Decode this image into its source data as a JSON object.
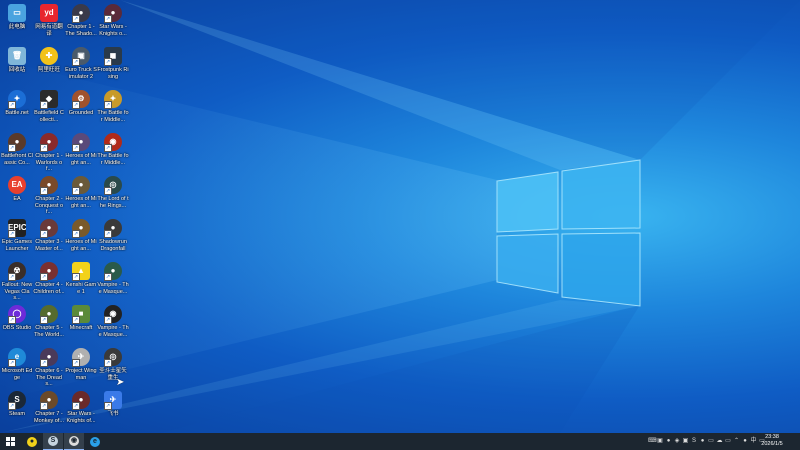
{
  "desktop_icons": [
    {
      "label": "此电脑",
      "icon": "this-pc-icon",
      "color": "#4aa3df",
      "glyph": "▭",
      "round": false,
      "shortcut": false
    },
    {
      "label": "回收站",
      "icon": "recycle-bin-icon",
      "color": "#7fb6d9",
      "glyph": "🗑",
      "round": false,
      "shortcut": false
    },
    {
      "label": "Battle.net",
      "icon": "battlenet-icon",
      "color": "#1b6ed6",
      "glyph": "✦",
      "round": true,
      "shortcut": true
    },
    {
      "label": "Battlefront Classic Co...",
      "icon": "battlefront-classic-icon",
      "color": "#5a3a2a",
      "glyph": "●",
      "round": true,
      "shortcut": true
    },
    {
      "label": "EA",
      "icon": "ea-icon",
      "color": "#e8402e",
      "glyph": "EA",
      "round": true,
      "shortcut": false
    },
    {
      "label": "Epic Games Launcher",
      "icon": "epic-games-icon",
      "color": "#222222",
      "glyph": "EPIC",
      "round": false,
      "shortcut": true
    },
    {
      "label": "Fallout: New Vegas Clas...",
      "icon": "fallout-icon",
      "color": "#3a2e2a",
      "glyph": "☢",
      "round": true,
      "shortcut": true
    },
    {
      "label": "OBS Studio",
      "icon": "obs-icon",
      "color": "#6d2bd9",
      "glyph": "◯",
      "round": true,
      "shortcut": true
    },
    {
      "label": "Microsoft Edge",
      "icon": "edge-icon",
      "color": "#1f8ad8",
      "glyph": "e",
      "round": true,
      "shortcut": true
    },
    {
      "label": "Steam",
      "icon": "steam-icon",
      "color": "#1b2838",
      "glyph": "S",
      "round": true,
      "shortcut": true
    },
    {
      "label": "网易有道翻译",
      "icon": "youdao-icon",
      "color": "#e8262e",
      "glyph": "yd",
      "round": false,
      "shortcut": false
    },
    {
      "label": "阿里旺旺",
      "icon": "aliwangwang-icon",
      "color": "#f2c21a",
      "glyph": "✚",
      "round": true,
      "shortcut": false
    },
    {
      "label": "Battlefield Collecti...",
      "icon": "battlefield-icon",
      "color": "#2b2b2b",
      "glyph": "◆",
      "round": false,
      "shortcut": true
    },
    {
      "label": "Chapter 1 - Warlords of...",
      "icon": "chapter1-icon",
      "color": "#8a2a2a",
      "glyph": "●",
      "round": true,
      "shortcut": true
    },
    {
      "label": "Chapter 2 - Conquest of...",
      "icon": "chapter2-icon",
      "color": "#7a4a2a",
      "glyph": "●",
      "round": true,
      "shortcut": true
    },
    {
      "label": "Chapter 3 - Master of...",
      "icon": "chapter3-icon",
      "color": "#6a3a3a",
      "glyph": "●",
      "round": true,
      "shortcut": true
    },
    {
      "label": "Chapter 4 - Children of...",
      "icon": "chapter4-icon",
      "color": "#7a3030",
      "glyph": "●",
      "round": true,
      "shortcut": true
    },
    {
      "label": "Chapter 5 - The World...",
      "icon": "chapter5-icon",
      "color": "#556b2f",
      "glyph": "●",
      "round": true,
      "shortcut": true
    },
    {
      "label": "Chapter 6 - The Dreads...",
      "icon": "chapter6-icon",
      "color": "#4a3a5a",
      "glyph": "●",
      "round": true,
      "shortcut": true
    },
    {
      "label": "Chapter 7 - Monkey of...",
      "icon": "chapter7-icon",
      "color": "#6b4a2a",
      "glyph": "●",
      "round": true,
      "shortcut": true
    },
    {
      "label": "Chapter 1 - The Shado...",
      "icon": "chapter-shado-icon",
      "color": "#3a3a4a",
      "glyph": "●",
      "round": true,
      "shortcut": true
    },
    {
      "label": "Euro Truck Simulator 2",
      "icon": "euro-truck-icon",
      "color": "#4a5a6a",
      "glyph": "▣",
      "round": true,
      "shortcut": true
    },
    {
      "label": "Grounded",
      "icon": "grounded-icon",
      "color": "#a0522d",
      "glyph": "⚙",
      "round": true,
      "shortcut": true
    },
    {
      "label": "Heroes of Might an...",
      "icon": "heroes1-icon",
      "color": "#5a4a7a",
      "glyph": "●",
      "round": true,
      "shortcut": true
    },
    {
      "label": "Heroes of Might an...",
      "icon": "heroes2-icon",
      "color": "#6a5a3a",
      "glyph": "●",
      "round": true,
      "shortcut": true
    },
    {
      "label": "Heroes of Might an...",
      "icon": "heroes3-icon",
      "color": "#7a5a2a",
      "glyph": "●",
      "round": true,
      "shortcut": true
    },
    {
      "label": "Kenshi Game 1",
      "icon": "kenshi-icon",
      "color": "#f2d21a",
      "glyph": "▲",
      "round": false,
      "shortcut": true
    },
    {
      "label": "Minecraft",
      "icon": "minecraft-icon",
      "color": "#5a8a3a",
      "glyph": "■",
      "round": false,
      "shortcut": true
    },
    {
      "label": "Project Wingman",
      "icon": "project-wingman-icon",
      "color": "#b0b0b0",
      "glyph": "✈",
      "round": true,
      "shortcut": true
    },
    {
      "label": "Star Wars - Knights of...",
      "icon": "kotor1-icon",
      "color": "#6a2a2a",
      "glyph": "●",
      "round": true,
      "shortcut": true
    },
    {
      "label": "Star Wars - Knights o...",
      "icon": "kotor2-icon",
      "color": "#5a2a3a",
      "glyph": "●",
      "round": true,
      "shortcut": true
    },
    {
      "label": "Frostpunk Rising",
      "icon": "frostpunk-icon",
      "color": "#2a3a4a",
      "glyph": "◼",
      "round": false,
      "shortcut": true
    },
    {
      "label": "The Battle for Middle...",
      "icon": "bfme1-icon",
      "color": "#c89a2a",
      "glyph": "✦",
      "round": true,
      "shortcut": true
    },
    {
      "label": "The Battle for Middle...",
      "icon": "bfme2-icon",
      "color": "#b02a1a",
      "glyph": "◉",
      "round": true,
      "shortcut": true
    },
    {
      "label": "The Lord of the Rings...",
      "icon": "lotr-icon",
      "color": "#2a4a4a",
      "glyph": "◎",
      "round": true,
      "shortcut": true
    },
    {
      "label": "Shadowrun Dragonfall",
      "icon": "shadowrun-icon",
      "color": "#3a3a3a",
      "glyph": "●",
      "round": true,
      "shortcut": true
    },
    {
      "label": "Vampire - The Masque...",
      "icon": "vampire-icon",
      "color": "#2a5a4a",
      "glyph": "●",
      "round": true,
      "shortcut": true
    },
    {
      "label": "Vampire - The Masque...",
      "icon": "vampire2-icon",
      "color": "#222222",
      "glyph": "◉",
      "round": true,
      "shortcut": true
    },
    {
      "label": "圣斗士星矢重生",
      "icon": "saint-seiya-icon",
      "color": "#3a3a3a",
      "glyph": "◎",
      "round": true,
      "shortcut": true
    },
    {
      "label": "飞书",
      "icon": "feishu-icon",
      "color": "#3a7ae8",
      "glyph": "✈",
      "round": false,
      "shortcut": true
    }
  ],
  "taskbar": {
    "start_icon": "windows-start-icon",
    "pinned": [
      {
        "name": "taskbar-app-yellow",
        "icon": "app-icon",
        "color": "#f2d21a",
        "glyph": "●",
        "active": false
      },
      {
        "name": "taskbar-steam",
        "icon": "steam-icon",
        "color": "#c7d5e0",
        "glyph": "S",
        "active": true
      },
      {
        "name": "taskbar-obs",
        "icon": "obs-icon",
        "color": "#dddddd",
        "glyph": "◉",
        "active": true
      },
      {
        "name": "taskbar-edge",
        "icon": "edge-icon",
        "color": "#2aa0e8",
        "glyph": "e",
        "active": false
      }
    ],
    "tray": [
      {
        "icon": "language-icon",
        "glyph": "⌨"
      },
      {
        "icon": "nvidia-icon",
        "glyph": "▣"
      },
      {
        "icon": "app-tray-icon",
        "glyph": "●"
      },
      {
        "icon": "shield-icon",
        "glyph": "◈"
      },
      {
        "icon": "lock-icon",
        "glyph": "▣"
      },
      {
        "icon": "steam-tray-icon",
        "glyph": "S"
      },
      {
        "icon": "wechat-icon",
        "glyph": "●"
      },
      {
        "icon": "network-icon",
        "glyph": "▭"
      },
      {
        "icon": "cloud-icon",
        "glyph": "☁"
      },
      {
        "icon": "app2-tray-icon",
        "glyph": "▭"
      },
      {
        "icon": "chevron-icon",
        "glyph": "⌃"
      },
      {
        "icon": "microphone-icon",
        "glyph": "●"
      },
      {
        "icon": "ime-icon",
        "glyph": "中"
      },
      {
        "icon": "notification-icon",
        "glyph": "▭"
      }
    ],
    "time": "23:38",
    "date": "2026/1/5"
  }
}
